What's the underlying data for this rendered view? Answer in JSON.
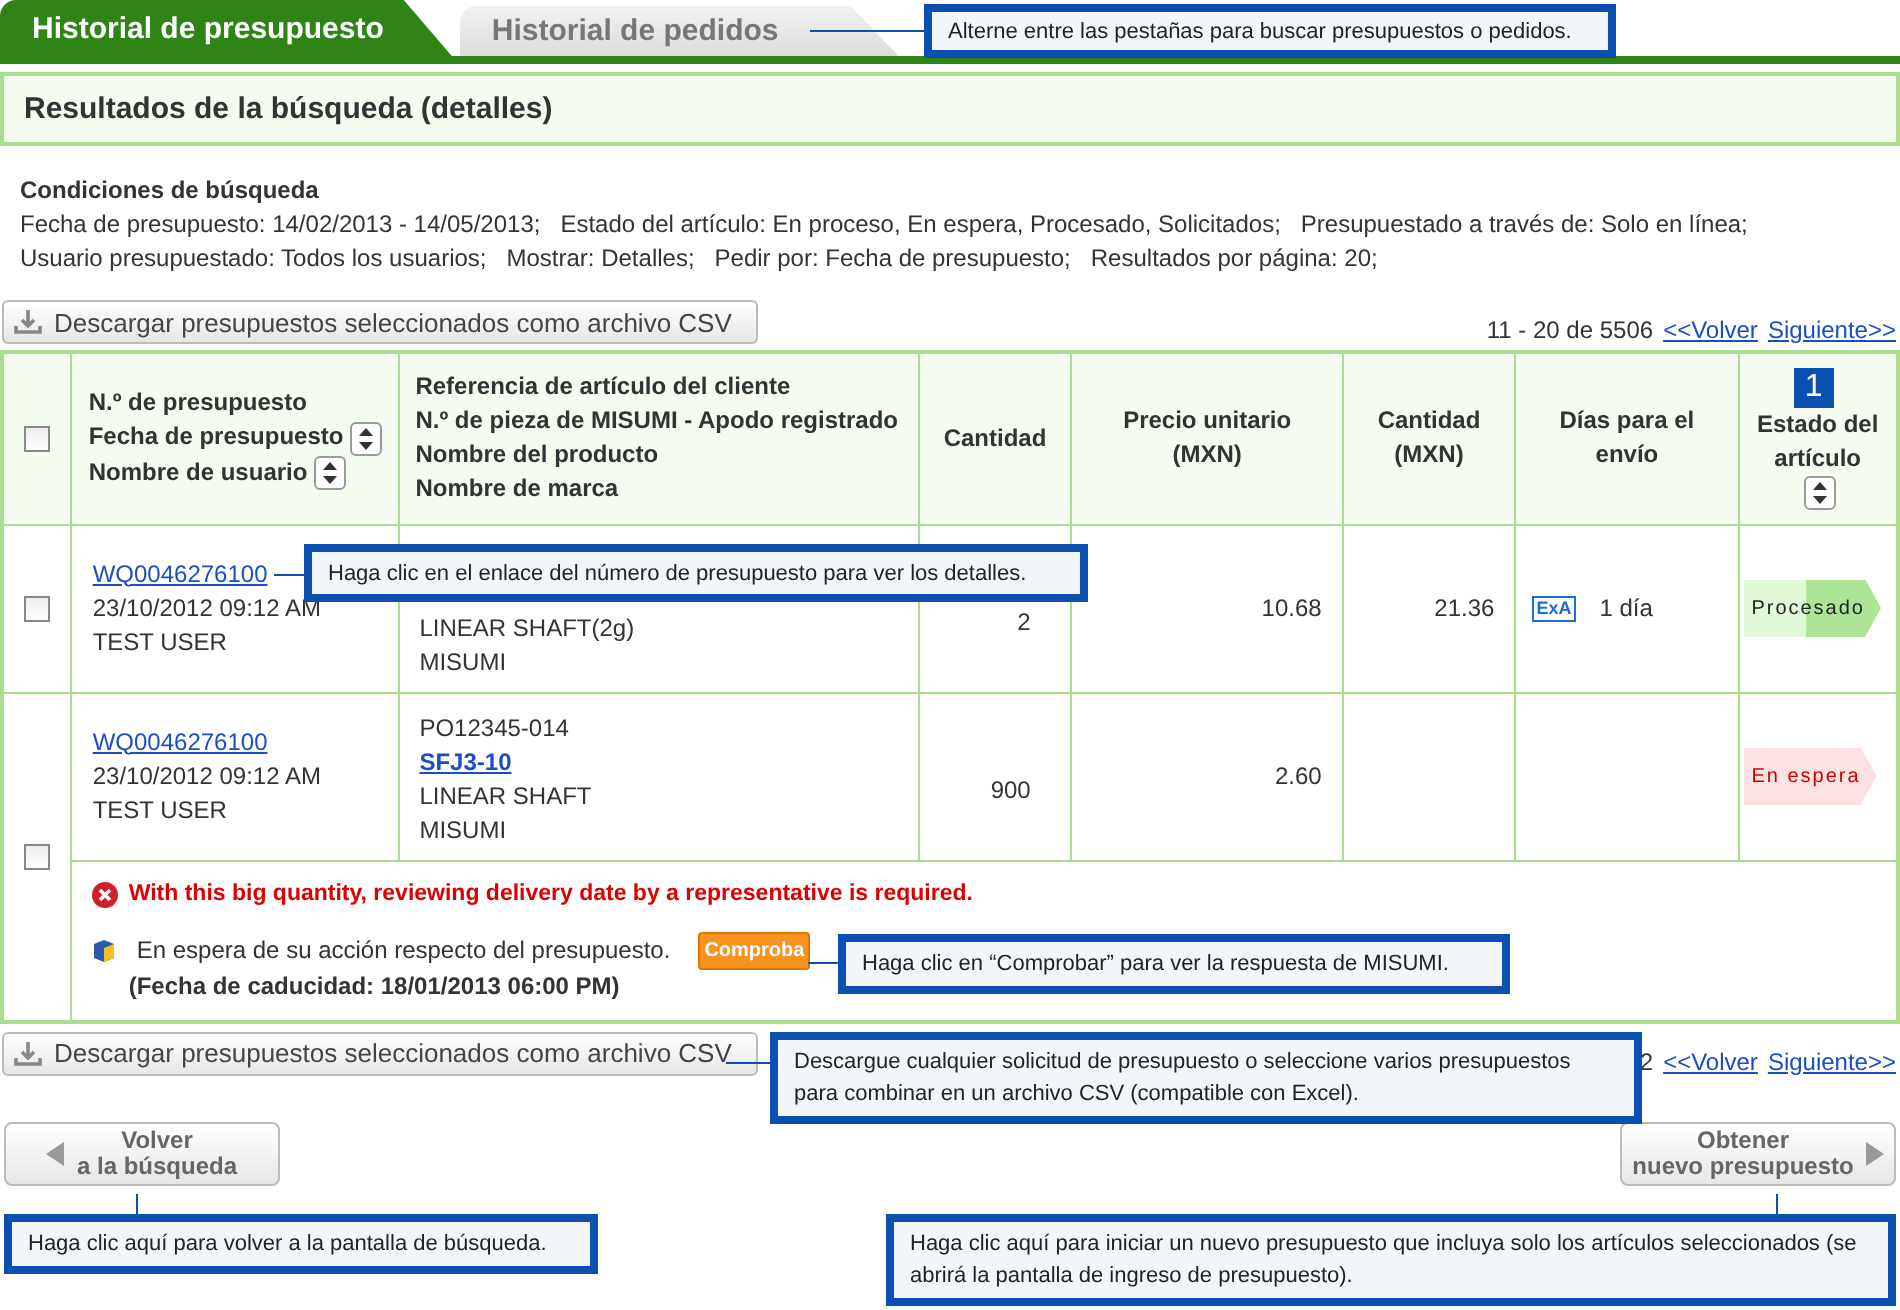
{
  "tabs": [
    {
      "label": "Historial de presupuesto",
      "selected": true
    },
    {
      "label": "Historial de pedidos",
      "selected": false
    }
  ],
  "section_title": "Resultados de la búsqueda (detalles)",
  "conditions": {
    "title": "Condiciones de búsqueda",
    "lines": [
      "Fecha de presupuesto: 14/02/2013 - 14/05/2013;   Estado del artículo: En proceso, En espera, Procesado, Solicitados;   Presupuestado a través de: Solo en línea;",
      "Usuario presupuestado: Todos los usuarios;   Mostrar: Detalles;   Pedir por: Fecha de presupuesto;   Resultados por página: 20;"
    ]
  },
  "csv_button_top": "Descargar presupuestos seleccionados como archivo CSV",
  "pager_top": {
    "range": "11 - 20 de 5506",
    "prev": "<<Volver",
    "next": "Siguiente>>"
  },
  "table": {
    "select_all": {
      "checked": false
    },
    "columns": [
      {
        "lines": [
          {
            "text": "N.º de presupuesto",
            "sortable": false
          },
          {
            "text": "Fecha de presupuesto",
            "sortable": true
          },
          {
            "text": "Nombre de usuario",
            "sortable": true
          }
        ]
      },
      {
        "lines": [
          {
            "text": "Referencia de artículo del cliente",
            "sortable": false
          },
          {
            "text": "N.º de pieza de MISUMI - Apodo registrado",
            "sortable": false
          },
          {
            "text": "Nombre del producto",
            "sortable": false
          },
          {
            "text": "Nombre de marca",
            "sortable": false
          }
        ]
      },
      {
        "lines": [
          {
            "text": "Cantidad",
            "sortable": false
          }
        ]
      },
      {
        "lines": [
          {
            "text": "Precio unitario (MXN)",
            "sortable": false
          }
        ]
      },
      {
        "lines": [
          {
            "text": "Cantidad (MXN)",
            "sortable": false
          }
        ]
      },
      {
        "lines": [
          {
            "text": "Días para el envío",
            "sortable": false
          }
        ]
      },
      {
        "lines": [
          {
            "text": "Estado del artículo",
            "sortable": true
          }
        ],
        "marker": "1"
      }
    ],
    "rows": [
      {
        "checked": false,
        "quote_no": "WQ0046276100",
        "date": "23/10/2012 09:12 AM",
        "user": "TEST USER",
        "item_lines": [
          {
            "text": "LINEAR SHAFT(2g)",
            "link": false
          },
          {
            "text": "MISUMI",
            "link": false
          }
        ],
        "quantity": "2",
        "unit_price": "10.68",
        "total": "21.36",
        "delivery": {
          "badge": "ExA",
          "days": "1 día"
        },
        "status": {
          "label": "Procesado",
          "kind": "processed"
        }
      },
      {
        "checked": false,
        "quote_no": "WQ0046276100",
        "date": "23/10/2012 09:12 AM",
        "user": "TEST USER",
        "item_lines": [
          {
            "text": "PO12345-014",
            "link": false
          },
          {
            "text": "SFJ3-10",
            "link": true
          },
          {
            "text": "LINEAR SHAFT",
            "link": false
          },
          {
            "text": "MISUMI",
            "link": false
          }
        ],
        "quantity": "900",
        "unit_price": "2.60",
        "status": {
          "label": "En espera",
          "kind": "waiting"
        },
        "alert": {
          "error": "With this big quantity, reviewing delivery date by a representative is required.",
          "notice": "En espera de su acción respecto del presupuesto.",
          "action": "Comproba",
          "expiry": "(Fecha de caducidad: 18/01/2013 06:00 PM)"
        }
      }
    ]
  },
  "csv_button_bottom": "Descargar presupuestos seleccionados como archivo CSV",
  "pager_bottom": {
    "range": "2",
    "prev": "<<Volver",
    "next": "Siguiente>>"
  },
  "back_button": {
    "lines": [
      "Volver",
      "a la búsqueda"
    ]
  },
  "new_quote_button": {
    "lines": [
      "Obtener",
      "nuevo presupuesto"
    ]
  },
  "callouts": [
    {
      "kind": "tabs",
      "text": "Alterne entre las pestañas para buscar presupuestos o pedidos."
    },
    {
      "kind": "quote_link",
      "text": "Haga clic en el enlace del número de presupuesto para ver los detalles."
    },
    {
      "kind": "check_button",
      "text": "Haga clic en “Comprobar” para ver la respuesta de MISUMI."
    },
    {
      "kind": "csv_button",
      "text": "Descargue cualquier solicitud de presupuesto o seleccione varios presupuestos para combinar en un archivo CSV (compatible con Excel)."
    },
    {
      "kind": "back_button",
      "text": "Haga clic aquí para volver a la pantalla de búsqueda."
    },
    {
      "kind": "new_quote_button",
      "text": "Haga clic aquí para iniciar un nuevo presupuesto que incluya solo los artículos seleccionados (se abrirá la pantalla de ingreso de presupuesto)."
    }
  ]
}
